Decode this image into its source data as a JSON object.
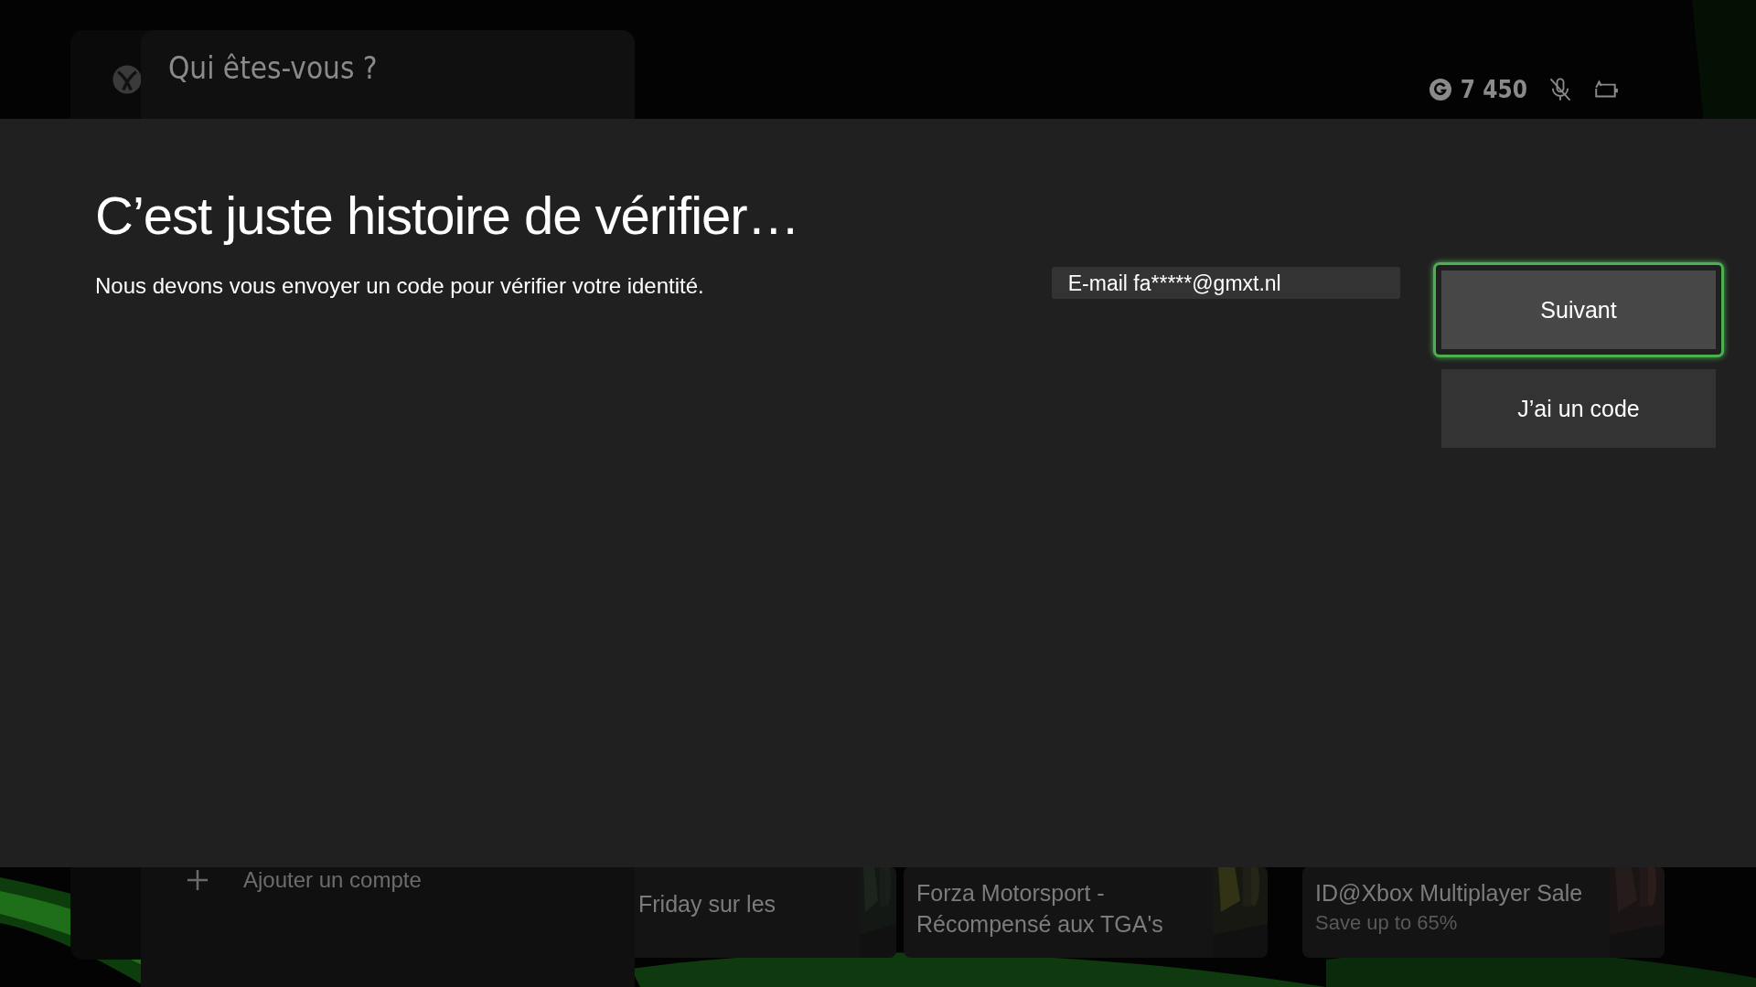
{
  "header": {
    "gamerscore": "7 450",
    "mic_muted": true
  },
  "profile_panel": {
    "title": "Qui êtes-vous ?",
    "add_account": "Ajouter un compte"
  },
  "cards": [
    {
      "title": "Friday sur les"
    },
    {
      "title": "Forza Motorsport - Récompensé aux TGA's"
    },
    {
      "title": "ID@Xbox Multiplayer Sale",
      "subtitle": "Save up to 65%"
    }
  ],
  "dialog": {
    "title": "C’est juste histoire de vérifier…",
    "message": "Nous devons vous envoyer un code pour vérifier votre identité.",
    "email_field": {
      "value": "E-mail fa*****@gmxt.nl"
    },
    "buttons": [
      {
        "label": "Suivant",
        "focused": true
      },
      {
        "label": "J’ai un code",
        "focused": false
      }
    ]
  }
}
